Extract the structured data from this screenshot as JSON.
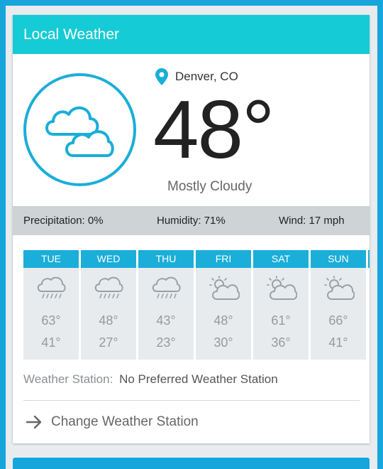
{
  "widget": {
    "title": "Local Weather"
  },
  "current": {
    "location": "Denver, CO",
    "temperature": "48°",
    "condition": "Mostly Cloudy",
    "icon": "cloudy-icon"
  },
  "stats": {
    "precipitation": "Precipitation: 0%",
    "humidity": "Humidity: 71%",
    "wind": "Wind: 17 mph"
  },
  "forecast": [
    {
      "day": "TUE",
      "icon": "rain-icon",
      "high": "63°",
      "low": "41°"
    },
    {
      "day": "WED",
      "icon": "rain-icon",
      "high": "48°",
      "low": "27°"
    },
    {
      "day": "THU",
      "icon": "rain-icon",
      "high": "43°",
      "low": "23°"
    },
    {
      "day": "FRI",
      "icon": "partly-cloudy-icon",
      "high": "48°",
      "low": "30°"
    },
    {
      "day": "SAT",
      "icon": "partly-cloudy-icon",
      "high": "61°",
      "low": "36°"
    },
    {
      "day": "SUN",
      "icon": "partly-cloudy-icon",
      "high": "66°",
      "low": "41°"
    }
  ],
  "station": {
    "label": "Weather Station:",
    "value": "No Preferred Weather Station"
  },
  "actions": {
    "change_station": "Change Weather Station"
  },
  "colors": {
    "header": "#15cbd5",
    "accent": "#1aaed8",
    "background": "#17a6dc",
    "stats_bar": "#ced3d6"
  }
}
